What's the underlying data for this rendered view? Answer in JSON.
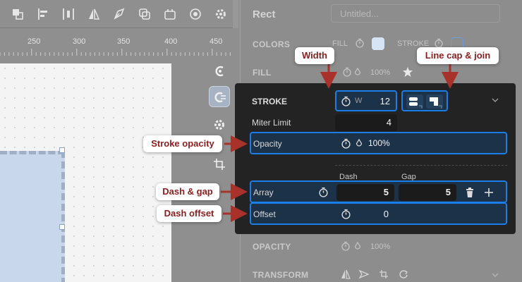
{
  "toolbar": {
    "icons": [
      "bring-to-front-icon",
      "align-left-icon",
      "distribute-horizontal-icon",
      "flip-horizontal-icon",
      "pen-tool-icon",
      "boolean-icon",
      "artboard-icon",
      "mask-icon",
      "settings-icon"
    ]
  },
  "ruler": {
    "labels": [
      "250",
      "300",
      "350",
      "400",
      "450"
    ]
  },
  "panel": {
    "title": "Rect",
    "name_placeholder": "Untitled...",
    "colors_label": "COLORS",
    "fill_short": "FILL",
    "stroke_short": "STROKE",
    "fill_label": "FILL",
    "fill_opacity": "100%",
    "opacity_label": "OPACITY",
    "opacity_value": "100%",
    "transform_label": "TRANSFORM",
    "fill_color": "#d6e4f5"
  },
  "stroke": {
    "title": "STROKE",
    "width_prefix": "W",
    "width_value": "12",
    "miter_label": "Miter Limit",
    "miter_value": "4",
    "opacity_label": "Opacity",
    "opacity_value": "100%",
    "dash_header": "Dash",
    "gap_header": "Gap",
    "array_label": "Array",
    "dash_value": "5",
    "gap_value": "5",
    "offset_label": "Offset",
    "offset_value": "0"
  },
  "callouts": {
    "width": "Width",
    "linecap": "Line cap & join",
    "stroke_opacity": "Stroke opacity",
    "dash_gap": "Dash & gap",
    "dash_offset": "Dash offset"
  },
  "colors": {
    "highlight": "#1a7ee8",
    "callout_text": "#8b1e1e",
    "arrow": "#a8322a",
    "panel_bg": "#232323"
  }
}
